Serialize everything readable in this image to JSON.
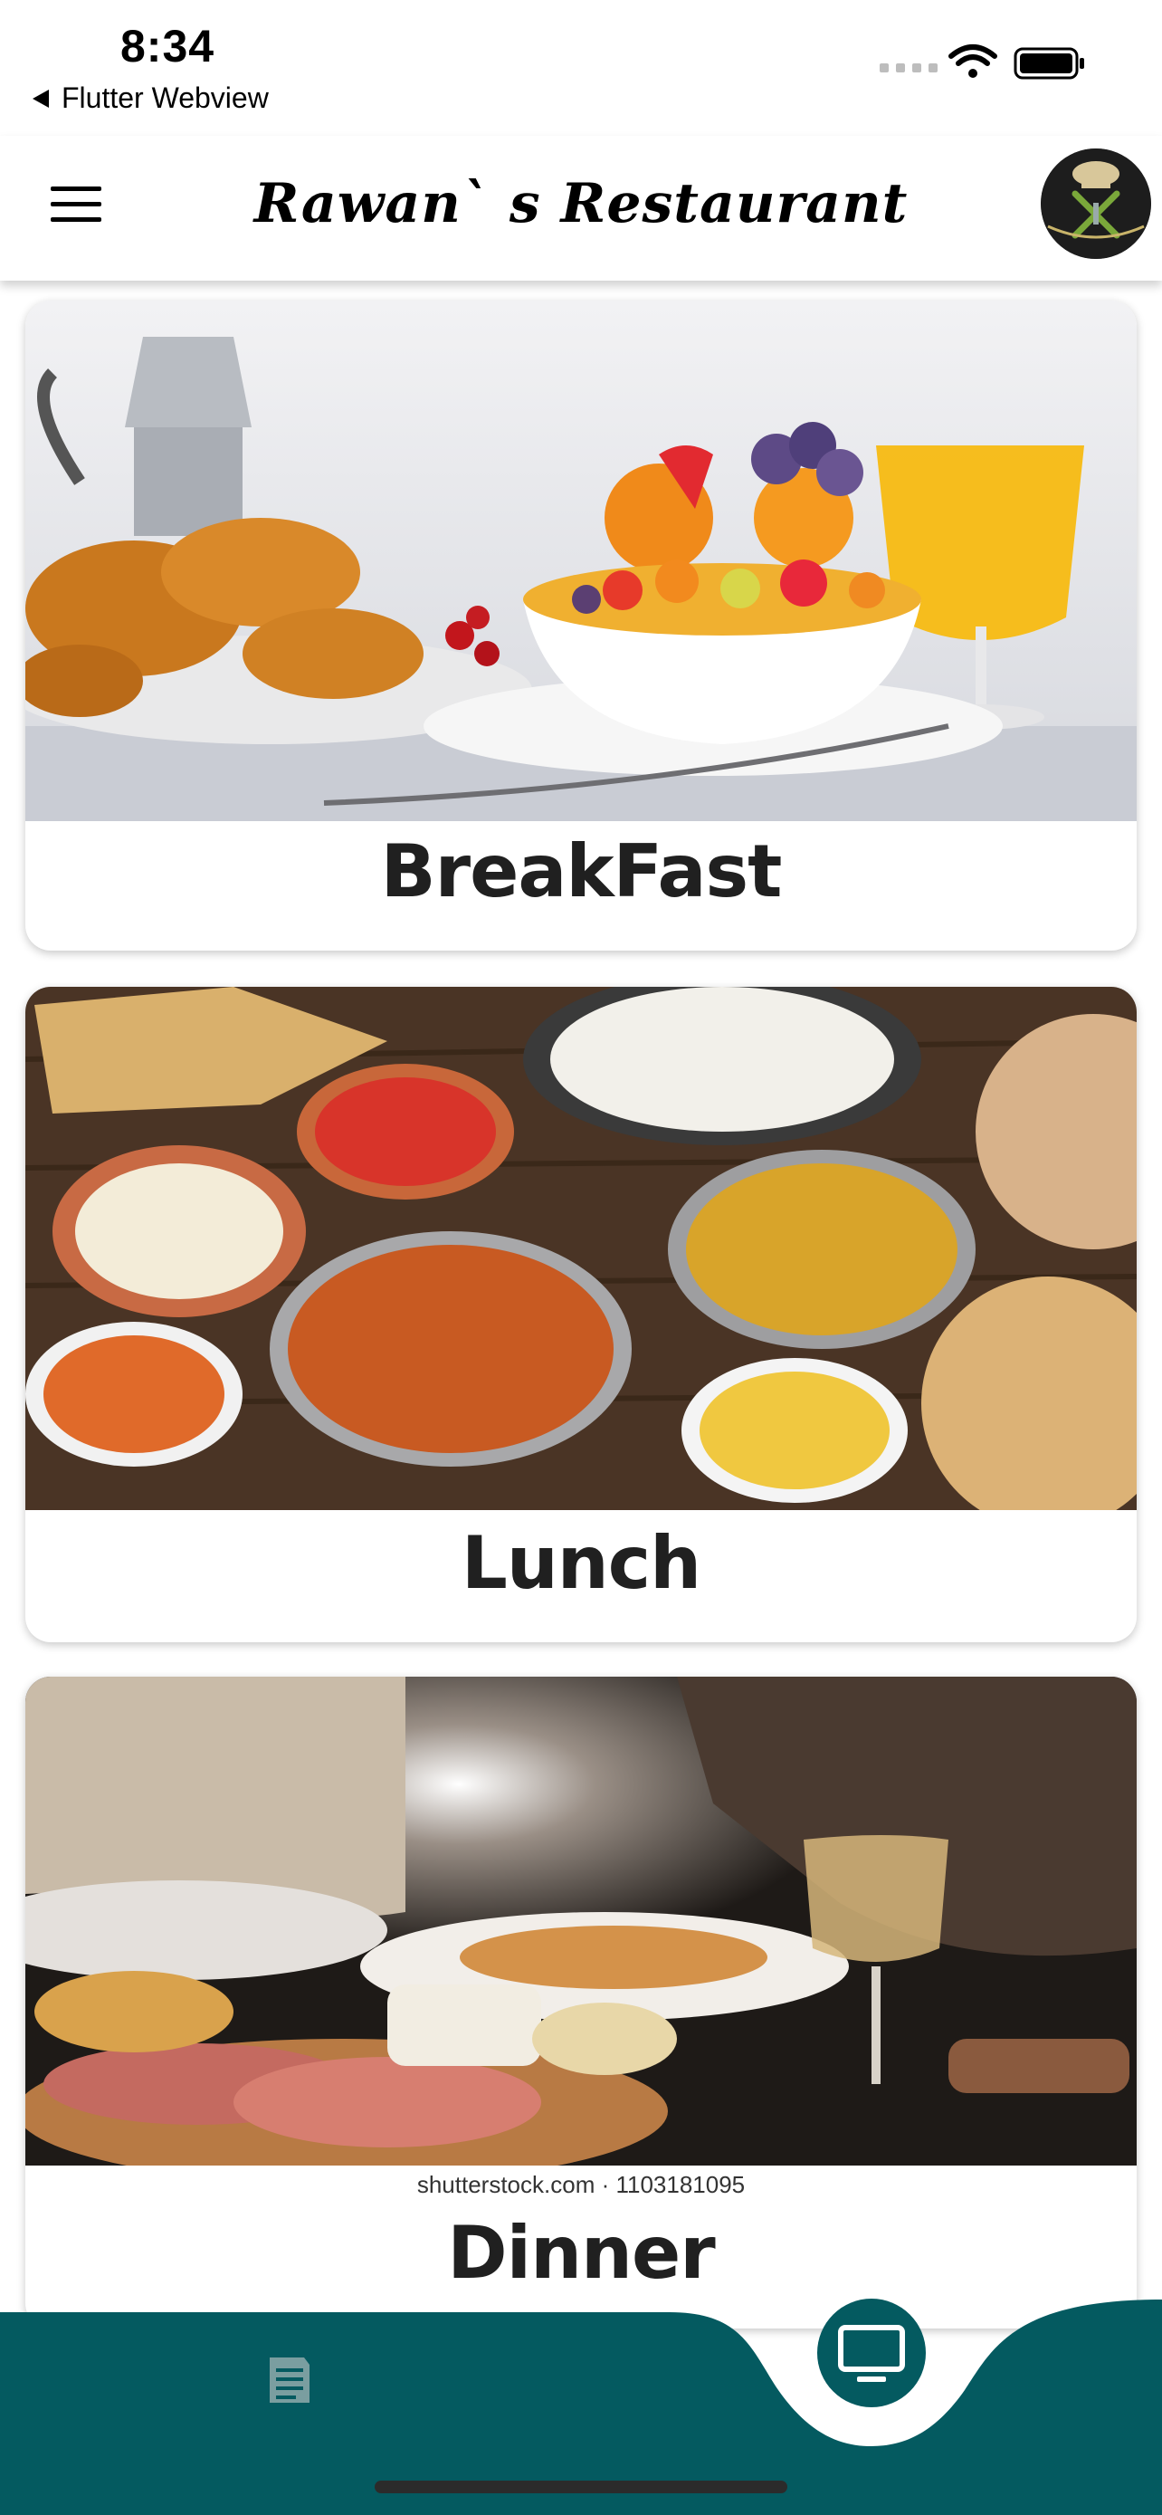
{
  "status_bar": {
    "time": "8:34",
    "back_app": "Flutter Webview"
  },
  "app_bar": {
    "title": "Rawan` s Restaurant"
  },
  "categories": [
    {
      "label": "BreakFast"
    },
    {
      "label": "Lunch"
    },
    {
      "label": "Dinner",
      "image_caption": "shutterstock.com · 1103181095"
    }
  ],
  "bottom_nav": {
    "items": [
      "document-icon",
      "monitor-icon"
    ]
  },
  "colors": {
    "nav_teal": "#045a60",
    "background": "#ffffff",
    "label_text": "#202020"
  }
}
